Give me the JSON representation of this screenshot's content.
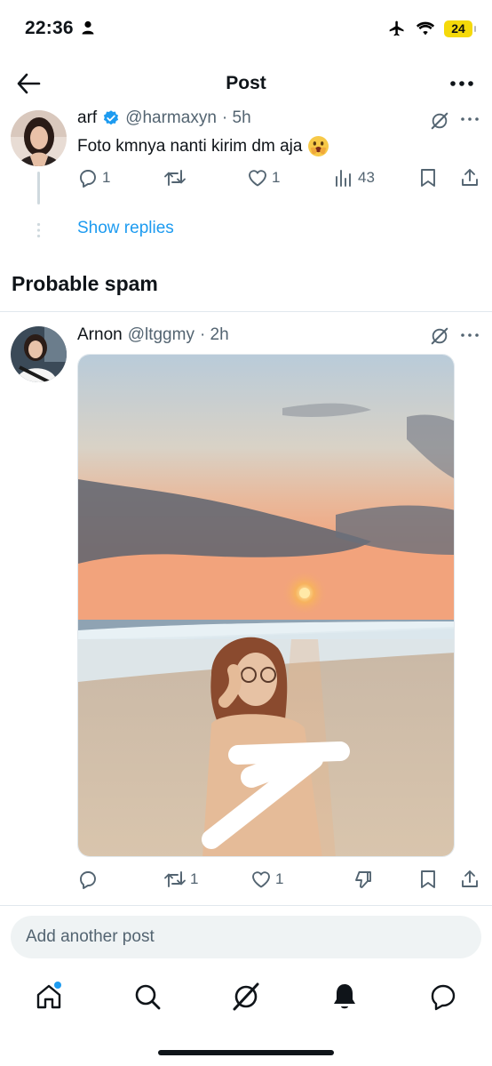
{
  "status_bar": {
    "time": "22:36",
    "battery": "24",
    "icons": [
      "person-icon",
      "airplane-icon",
      "wifi-icon",
      "battery-icon"
    ]
  },
  "header": {
    "title": "Post",
    "back_icon": "arrow-left-icon",
    "more_icon": "more-horizontal-icon"
  },
  "parent_post": {
    "name": "arf",
    "verified": true,
    "handle": "@harmaxyn",
    "time": "· 5h",
    "text": "Foto kmnya nanti kirim dm aja",
    "emoji": "face-with-hand-over-mouth",
    "actions": {
      "replies": "1",
      "reposts": "",
      "likes": "1",
      "views": "43"
    }
  },
  "show_replies": "Show replies",
  "section": {
    "title": "Probable spam"
  },
  "reply_post": {
    "name": "Arnon",
    "handle": "@ltggmy",
    "time": "· 2h",
    "media": "beach-sunset-photo",
    "actions": {
      "replies": "",
      "reposts": "1",
      "likes": "1"
    }
  },
  "composer": {
    "placeholder": "Add another post"
  },
  "tab_bar": [
    "home-icon",
    "search-icon",
    "grok-icon",
    "notifications-icon",
    "messages-icon"
  ],
  "colors": {
    "accent": "#1d9bf0",
    "text": "#0f1419",
    "secondary": "#536471",
    "battery": "#f5d90a"
  }
}
